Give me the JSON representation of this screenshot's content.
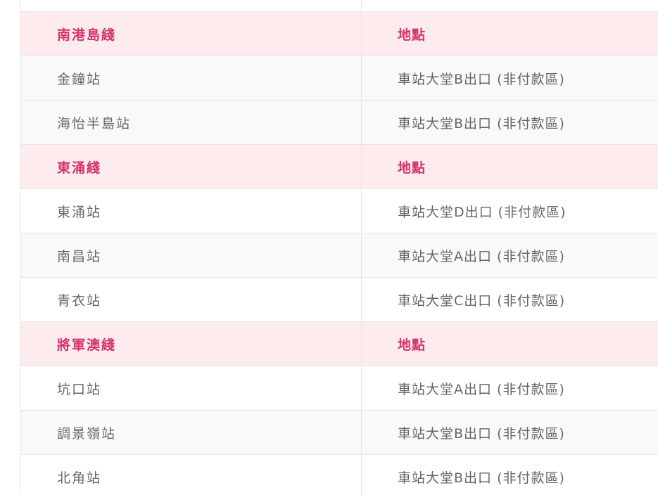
{
  "table": {
    "sections": [
      {
        "line": "南港島綫",
        "location_header": "地點",
        "stations": [
          {
            "name": "金鐘站",
            "location": "車站大堂B出口 (非付款區)"
          },
          {
            "name": "海怡半島站",
            "location": "車站大堂B出口 (非付款區)"
          }
        ]
      },
      {
        "line": "東涌綫",
        "location_header": "地點",
        "stations": [
          {
            "name": "東涌站",
            "location": "車站大堂D出口 (非付款區)"
          },
          {
            "name": "南昌站",
            "location": "車站大堂A出口 (非付款區)"
          },
          {
            "name": "青衣站",
            "location": "車站大堂C出口 (非付款區)"
          }
        ]
      },
      {
        "line": "將軍澳綫",
        "location_header": "地點",
        "stations": [
          {
            "name": "坑口站",
            "location": "車站大堂A出口 (非付款區)"
          },
          {
            "name": "調景嶺站",
            "location": "車站大堂B出口 (非付款區)"
          },
          {
            "name": "北角站",
            "location": "車站大堂B出口 (非付款區)"
          }
        ]
      }
    ]
  },
  "colors": {
    "header_background": "#fdebee",
    "header_text": "#d6336c",
    "row_text": "#666666",
    "row_alt_background": "#f9f9fa",
    "border": "#e6e6ea"
  }
}
